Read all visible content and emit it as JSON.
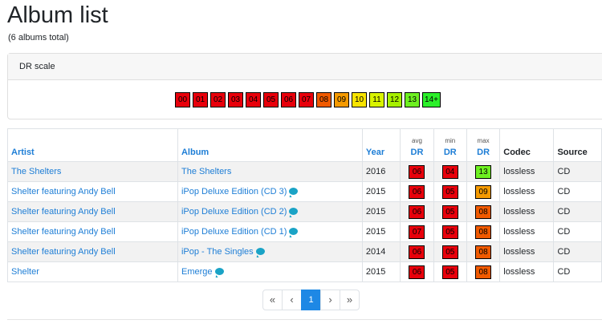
{
  "page": {
    "title": "Album list",
    "subtitle": "(6 albums total)"
  },
  "dr_scale": {
    "header": "DR scale",
    "levels": [
      {
        "label": "00",
        "color": "#e8000b"
      },
      {
        "label": "01",
        "color": "#e8000b"
      },
      {
        "label": "02",
        "color": "#e8000b"
      },
      {
        "label": "03",
        "color": "#e8000b"
      },
      {
        "label": "04",
        "color": "#e8000b"
      },
      {
        "label": "05",
        "color": "#e8000b"
      },
      {
        "label": "06",
        "color": "#e8000b"
      },
      {
        "label": "07",
        "color": "#e8000b"
      },
      {
        "label": "08",
        "color": "#f05a00"
      },
      {
        "label": "09",
        "color": "#f59a00"
      },
      {
        "label": "10",
        "color": "#f8e400"
      },
      {
        "label": "11",
        "color": "#d9f400"
      },
      {
        "label": "12",
        "color": "#a6f000"
      },
      {
        "label": "13",
        "color": "#6ef021"
      },
      {
        "label": "14+",
        "color": "#2cf02a"
      }
    ]
  },
  "table": {
    "headers": {
      "artist": "Artist",
      "album": "Album",
      "year": "Year",
      "avg_sub": "avg",
      "min_sub": "min",
      "max_sub": "max",
      "dr": "DR",
      "codec": "Codec",
      "source": "Source"
    },
    "rows": [
      {
        "artist": "The Shelters",
        "album": "The Shelters",
        "comment": false,
        "year": "2016",
        "avg": "06",
        "min": "04",
        "max": "13",
        "codec": "lossless",
        "source": "CD"
      },
      {
        "artist": "Shelter featuring Andy Bell",
        "album": "iPop Deluxe Edition (CD 3)",
        "comment": true,
        "year": "2015",
        "avg": "06",
        "min": "05",
        "max": "09",
        "codec": "lossless",
        "source": "CD"
      },
      {
        "artist": "Shelter featuring Andy Bell",
        "album": "iPop Deluxe Edition (CD 2)",
        "comment": true,
        "year": "2015",
        "avg": "06",
        "min": "05",
        "max": "08",
        "codec": "lossless",
        "source": "CD"
      },
      {
        "artist": "Shelter featuring Andy Bell",
        "album": "iPop Deluxe Edition (CD 1)",
        "comment": true,
        "year": "2015",
        "avg": "07",
        "min": "05",
        "max": "08",
        "codec": "lossless",
        "source": "CD"
      },
      {
        "artist": "Shelter featuring Andy Bell",
        "album": "iPop - The Singles",
        "comment": true,
        "year": "2014",
        "avg": "06",
        "min": "05",
        "max": "08",
        "codec": "lossless",
        "source": "CD"
      },
      {
        "artist": "Shelter",
        "album": "Emerge",
        "comment": true,
        "year": "2015",
        "avg": "06",
        "min": "05",
        "max": "08",
        "codec": "lossless",
        "source": "CD"
      }
    ]
  },
  "pagination": {
    "first": "«",
    "prev": "‹",
    "current": "1",
    "next": "›",
    "last": "»"
  }
}
